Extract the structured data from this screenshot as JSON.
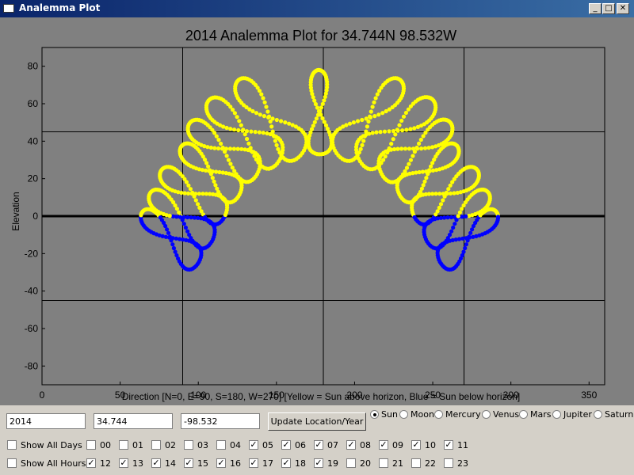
{
  "window": {
    "title": "Analemma Plot",
    "minimize": "_",
    "maximize": "□",
    "close": "✕"
  },
  "chart_data": {
    "type": "scatter",
    "title": "2014 Analemma Plot for  34.744N  98.532W",
    "xlabel": "Direction [N=0, E=90, S=180, W=270] [Yellow = Sun above horizon, Blue = Sun below horizon]",
    "ylabel": "Elevation",
    "xlim": [
      0,
      360
    ],
    "ylim": [
      -90,
      90
    ],
    "xticks": [
      0,
      50,
      100,
      150,
      200,
      250,
      300,
      350
    ],
    "yticks": [
      80,
      60,
      40,
      20,
      0,
      -20,
      -40,
      -60,
      -80
    ],
    "guide_lines_x": [
      90,
      180,
      270
    ],
    "guide_lines_y": [
      45,
      -45
    ],
    "horizon_y": 0,
    "colors": {
      "background": "#808080",
      "above_horizon": "#ffff00",
      "below_horizon": "#0000ff",
      "axes": "#000000"
    },
    "series": [
      {
        "name": "Sun above horizon",
        "color": "#ffff00"
      },
      {
        "name": "Sun below horizon",
        "color": "#0000ff"
      }
    ],
    "analemmas": [
      {
        "top": [
          64,
          2
        ],
        "bottom": [
          100,
          -25
        ]
      },
      {
        "top": [
          69,
          12
        ],
        "bottom": [
          109,
          -13
        ]
      },
      {
        "top": [
          76,
          24
        ],
        "bottom": [
          117,
          0
        ]
      },
      {
        "top": [
          89,
          37
        ],
        "bottom": [
          126,
          11
        ]
      },
      {
        "top": [
          94,
          49
        ],
        "bottom": [
          138,
          23
        ]
      },
      {
        "top": [
          106,
          61
        ],
        "bottom": [
          152,
          30
        ]
      },
      {
        "top": [
          125,
          72
        ],
        "bottom": [
          166,
          33
        ]
      },
      {
        "top": [
          177,
          78
        ],
        "bottom": [
          178,
          33
        ]
      },
      {
        "top": [
          230,
          72
        ],
        "bottom": [
          189,
          33
        ]
      },
      {
        "top": [
          251,
          61
        ],
        "bottom": [
          203,
          30
        ]
      },
      {
        "top": [
          262,
          49
        ],
        "bottom": [
          217,
          23
        ]
      },
      {
        "top": [
          266,
          37
        ],
        "bottom": [
          229,
          11
        ]
      },
      {
        "top": [
          279,
          24
        ],
        "bottom": [
          238,
          0
        ]
      },
      {
        "top": [
          286,
          12
        ],
        "bottom": [
          246,
          -13
        ]
      },
      {
        "top": [
          291,
          2
        ],
        "bottom": [
          255,
          -25
        ]
      }
    ]
  },
  "controls": {
    "year": "2014",
    "latitude": "34.744",
    "longitude": "-98.532",
    "update_button": "Update Location/Year",
    "bodies": [
      {
        "label": "Sun",
        "selected": true
      },
      {
        "label": "Moon",
        "selected": false
      },
      {
        "label": "Mercury",
        "selected": false
      },
      {
        "label": "Venus",
        "selected": false
      },
      {
        "label": "Mars",
        "selected": false
      },
      {
        "label": "Jupiter",
        "selected": false
      },
      {
        "label": "Saturn",
        "selected": false
      }
    ],
    "show_all_days": {
      "label": "Show All Days",
      "checked": false
    },
    "show_all_hours": {
      "label": "Show All Hours",
      "checked": false
    },
    "hours_row1": [
      {
        "label": "00",
        "checked": false
      },
      {
        "label": "01",
        "checked": false
      },
      {
        "label": "02",
        "checked": false
      },
      {
        "label": "03",
        "checked": false
      },
      {
        "label": "04",
        "checked": false
      },
      {
        "label": "05",
        "checked": true
      },
      {
        "label": "06",
        "checked": true
      },
      {
        "label": "07",
        "checked": true
      },
      {
        "label": "08",
        "checked": true
      },
      {
        "label": "09",
        "checked": true
      },
      {
        "label": "10",
        "checked": true
      },
      {
        "label": "11",
        "checked": true
      }
    ],
    "hours_row2": [
      {
        "label": "12",
        "checked": true
      },
      {
        "label": "13",
        "checked": true
      },
      {
        "label": "14",
        "checked": true
      },
      {
        "label": "15",
        "checked": true
      },
      {
        "label": "16",
        "checked": true
      },
      {
        "label": "17",
        "checked": true
      },
      {
        "label": "18",
        "checked": true
      },
      {
        "label": "19",
        "checked": true
      },
      {
        "label": "20",
        "checked": false
      },
      {
        "label": "21",
        "checked": false
      },
      {
        "label": "22",
        "checked": false
      },
      {
        "label": "23",
        "checked": false
      }
    ]
  }
}
